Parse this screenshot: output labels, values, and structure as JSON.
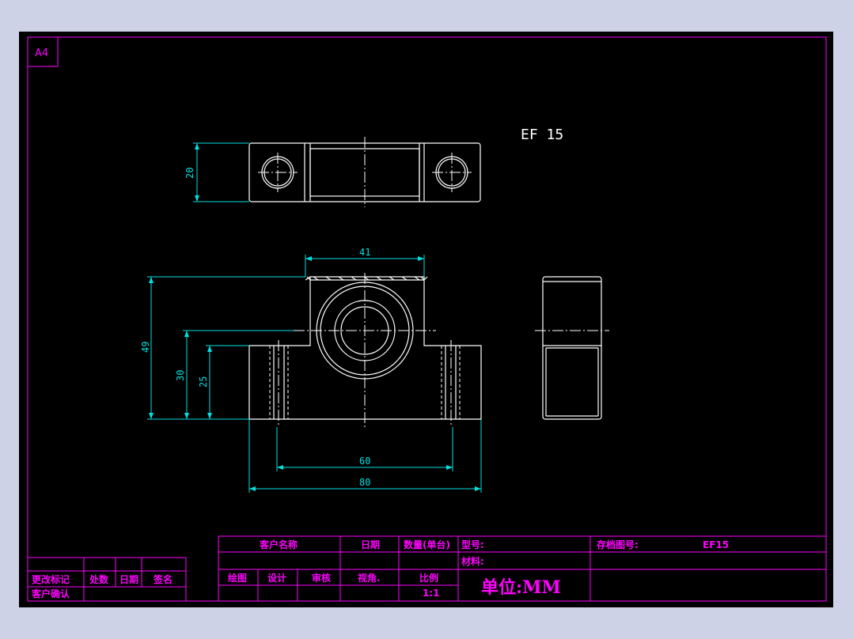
{
  "sheet": {
    "paper_size": "A4",
    "part_label": "EF 15"
  },
  "dimensions": {
    "top_view_height": "20",
    "top_width": "41",
    "total_height": "49",
    "center_height": "30",
    "base_height": "25",
    "hole_spacing": "60",
    "total_width": "80"
  },
  "title_block": {
    "customer_name": "客户名称",
    "date": "日期",
    "quantity": "数量(单台)",
    "model_label": "型号:",
    "archive_no_label": "存档图号:",
    "archive_no_value": "EF15",
    "material_label": "材料:",
    "drawing": "绘图",
    "design": "设计",
    "review": "审核",
    "view_angle": "视角.",
    "scale_label": "比例",
    "scale_value": "1:1",
    "unit": "单位:MM",
    "revision_mark": "更改标记",
    "revision_count": "处数",
    "revision_date": "日期",
    "signature": "签名",
    "customer_confirm": "客户确认"
  },
  "colors": {
    "background": "#000000",
    "border": "#ff00ff",
    "geometry": "#ffffff",
    "dimension": "#00e0e0"
  }
}
